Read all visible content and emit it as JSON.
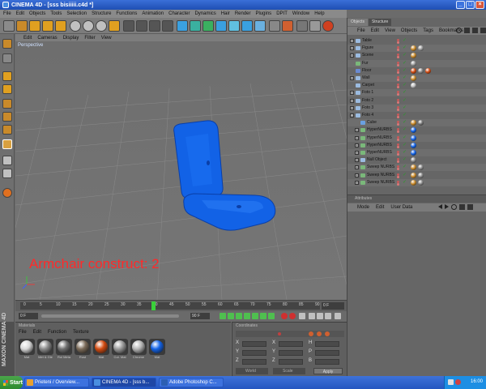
{
  "window": {
    "title": "CINEMA 4D - [sss bisiiiii.c4d *]"
  },
  "menubar": [
    "File",
    "Edit",
    "Objects",
    "Tools",
    "Selection",
    "Structure",
    "Functions",
    "Animation",
    "Character",
    "Dynamics",
    "Hair",
    "Render",
    "Plugins",
    "DPIT",
    "Window",
    "Help"
  ],
  "viewport": {
    "menu": [
      "Edit",
      "Cameras",
      "Display",
      "Filter",
      "View"
    ],
    "label": "Perspective",
    "annotation": "Armchair construct: 2",
    "annotation_color": "#ff2a2a",
    "object_color": "#1262e6"
  },
  "timeline": {
    "ticks": [
      "0",
      "5",
      "10",
      "15",
      "20",
      "25",
      "30",
      "35",
      "40",
      "45",
      "50",
      "55",
      "60",
      "65",
      "70",
      "75",
      "80",
      "85",
      "90"
    ],
    "current_frame": "0 F",
    "start_field": "0 F",
    "end_field": "90 F"
  },
  "materials": {
    "title": "Materials",
    "menu": [
      "File",
      "Edit",
      "Function",
      "Texture"
    ],
    "items": [
      {
        "name": "Mat",
        "color": "#d8d8d8"
      },
      {
        "name": "Met & Gle",
        "color": "#8a8a8a"
      },
      {
        "name": "Rol Meta",
        "color": "#6f6f6f"
      },
      {
        "name": "Rust",
        "color": "#7a6a58"
      },
      {
        "name": "Mat",
        "color": "#d24a10"
      },
      {
        "name": "Cut. Mat",
        "color": "#9a9a9a"
      },
      {
        "name": "Chrome",
        "color": "#b5b5b5"
      },
      {
        "name": "Mat",
        "color": "#1262e6"
      }
    ]
  },
  "maxon": {
    "text": "MAXON CINEMA 4D"
  },
  "coordinates": {
    "title": "Coordinates",
    "rows": [
      {
        "a": "X",
        "b": "X",
        "c": "H"
      },
      {
        "a": "Y",
        "b": "Y",
        "c": "P"
      },
      {
        "a": "Z",
        "b": "Z",
        "c": "B"
      }
    ],
    "world": "World",
    "scale": "Scale",
    "apply": "Apply"
  },
  "objects": {
    "tabs": [
      "Objects",
      "Structure"
    ],
    "menu": [
      "File",
      "Edit",
      "View",
      "Objects",
      "Tags",
      "Bookmarks"
    ],
    "rows": [
      {
        "name": "Table",
        "icon": "#9bbbe0",
        "expand": "+",
        "check": true,
        "tags": []
      },
      {
        "name": "Figure",
        "icon": "#9bbbe0",
        "expand": "+",
        "check": true,
        "tags": [
          "#c98a2a",
          "#999"
        ]
      },
      {
        "name": "Scene",
        "icon": "#9bbbe0",
        "expand": "+",
        "check": true,
        "tags": [
          "#c98a2a"
        ]
      },
      {
        "name": "Fur",
        "icon": "#7ab87a",
        "expand": "",
        "check": true,
        "tags": [
          "#9a9a9a"
        ]
      },
      {
        "name": "Floor",
        "icon": "#6a8ad0",
        "expand": "",
        "check": true,
        "tags": [
          "#d24a10",
          "#888",
          "#d24a10"
        ]
      },
      {
        "name": "Wall",
        "icon": "#9bbbe0",
        "expand": "+",
        "check": true,
        "tags": [
          "#c98a2a"
        ]
      },
      {
        "name": "Carpet",
        "icon": "#9bbbe0",
        "expand": "",
        "check": true,
        "tags": [
          "#bbbbbb"
        ]
      },
      {
        "name": "Foto 1",
        "icon": "#9bbbe0",
        "expand": "+",
        "check": true,
        "tags": []
      },
      {
        "name": "Foto 2",
        "icon": "#9bbbe0",
        "expand": "+",
        "check": true,
        "tags": []
      },
      {
        "name": "Foto 3",
        "icon": "#9bbbe0",
        "expand": "+",
        "check": true,
        "tags": []
      },
      {
        "name": "Foto 4",
        "icon": "#9bbbe0",
        "expand": "-",
        "check": true,
        "tags": []
      },
      {
        "name": "Cube",
        "icon": "#6aa0e0",
        "expand": "",
        "check": true,
        "tags": [
          "#c98a2a",
          "#777"
        ]
      },
      {
        "name": "HyperNURBS",
        "icon": "#7ab87a",
        "expand": "+",
        "check": true,
        "tags": [
          "#1262e6"
        ]
      },
      {
        "name": "HyperNURBS",
        "icon": "#7ab87a",
        "expand": "+",
        "check": true,
        "tags": [
          "#1262e6"
        ]
      },
      {
        "name": "HyperNURBS",
        "icon": "#7ab87a",
        "expand": "+",
        "check": true,
        "tags": [
          "#1262e6"
        ]
      },
      {
        "name": "HyperNURBS",
        "icon": "#7ab87a",
        "expand": "+",
        "check": true,
        "tags": [
          "#1262e6"
        ]
      },
      {
        "name": "Null Object",
        "icon": "#9bbbe0",
        "expand": "+",
        "check": true,
        "tags": [
          "#888"
        ]
      },
      {
        "name": "Sweep NURBS",
        "icon": "#7ab87a",
        "expand": "+",
        "check": true,
        "tags": [
          "#c98a2a",
          "#888"
        ]
      },
      {
        "name": "Sweep NURBS",
        "icon": "#7ab87a",
        "expand": "+",
        "check": true,
        "tags": [
          "#c98a2a",
          "#888"
        ]
      },
      {
        "name": "Sweep NURBS",
        "icon": "#7ab87a",
        "expand": "+",
        "check": true,
        "tags": [
          "#c98a2a",
          "#888"
        ]
      }
    ]
  },
  "attributes": {
    "title": "Attributes",
    "menu": [
      "Mode",
      "Edit",
      "User Data"
    ]
  },
  "taskbar": {
    "start": "Start",
    "tasks": [
      {
        "label": "Prieteni / Overview...",
        "icon": "#e8a030",
        "active": false
      },
      {
        "label": "CINEMA 4D - [sss b...",
        "icon": "#4a8fe0",
        "active": true
      },
      {
        "label": "Adobe Photoshop C...",
        "icon": "#2b5fb3",
        "active": false
      }
    ],
    "clock": "16:00"
  }
}
